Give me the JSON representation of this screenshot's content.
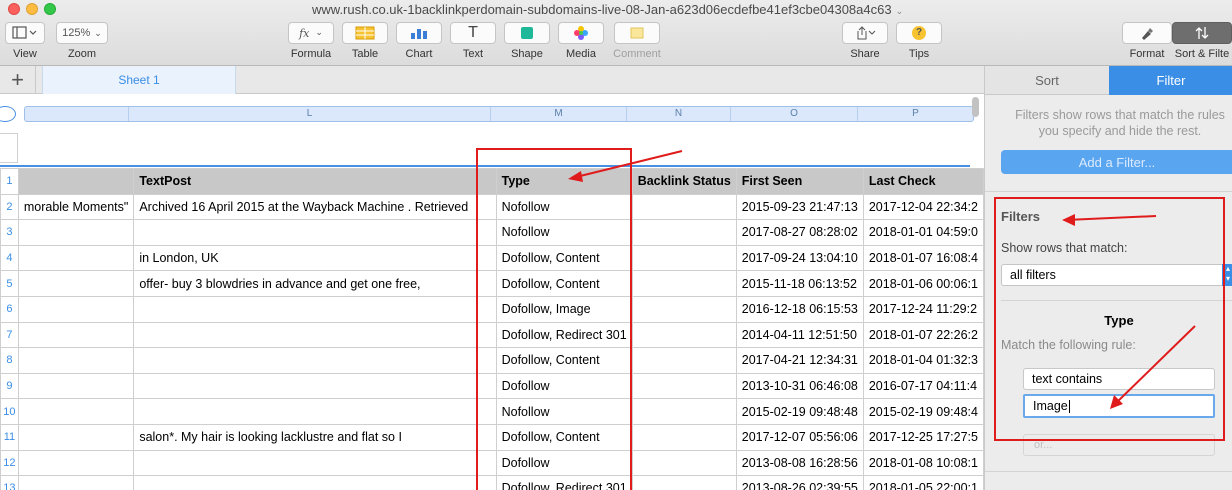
{
  "window": {
    "title": "www.rush.co.uk-1backlinkperdomain-subdomains-live-08-Jan-a623d06ecdefbe41ef3cbe04308a4c63"
  },
  "toolbar": {
    "view": "View",
    "zoom_value": "125%",
    "zoom": "Zoom",
    "formula_icon": "fx",
    "formula": "Formula",
    "table": "Table",
    "chart": "Chart",
    "text": "Text",
    "text_icon": "T",
    "shape": "Shape",
    "media": "Media",
    "comment": "Comment",
    "share": "Share",
    "tips": "Tips",
    "tips_icon": "?",
    "format": "Format",
    "sort_filter": "Sort & Filte"
  },
  "sheet": {
    "tab": "Sheet 1",
    "col_letters": [
      "L",
      "M",
      "N",
      "O",
      "P"
    ],
    "headers": [
      "",
      "TextPost",
      "Type",
      "Backlink Status",
      "First Seen",
      "Last Check"
    ],
    "rows": [
      {
        "n": "2",
        "k": "morable Moments\"",
        "textpost": "Archived 16 April 2015 at the Wayback Machine . Retrieved",
        "type": "Nofollow",
        "status": "",
        "first": "2015-09-23 21:47:13",
        "last": "2017-12-04 22:34:2"
      },
      {
        "n": "3",
        "k": "",
        "textpost": "",
        "type": "Nofollow",
        "status": "",
        "first": "2017-08-27 08:28:02",
        "last": "2018-01-01 04:59:0"
      },
      {
        "n": "4",
        "k": "",
        "textpost": "in London, UK",
        "type": "Dofollow, Content",
        "status": "",
        "first": "2017-09-24 13:04:10",
        "last": "2018-01-07 16:08:4"
      },
      {
        "n": "5",
        "k": "",
        "textpost": "offer- buy 3 blowdries in advance and get one free,",
        "type": "Dofollow, Content",
        "status": "",
        "first": "2015-11-18 06:13:52",
        "last": "2018-01-06 00:06:1"
      },
      {
        "n": "6",
        "k": "",
        "textpost": "",
        "type": "Dofollow, Image",
        "status": "",
        "first": "2016-12-18 06:15:53",
        "last": "2017-12-24 11:29:2"
      },
      {
        "n": "7",
        "k": "",
        "textpost": "",
        "type": "Dofollow, Redirect 301",
        "status": "",
        "first": "2014-04-11 12:51:50",
        "last": "2018-01-07 22:26:2"
      },
      {
        "n": "8",
        "k": "",
        "textpost": "",
        "type": "Dofollow, Content",
        "status": "",
        "first": "2017-04-21 12:34:31",
        "last": "2018-01-04 01:32:3"
      },
      {
        "n": "9",
        "k": "",
        "textpost": "",
        "type": "Dofollow",
        "status": "",
        "first": "2013-10-31 06:46:08",
        "last": "2016-07-17 04:11:4"
      },
      {
        "n": "10",
        "k": "",
        "textpost": "",
        "type": "Nofollow",
        "status": "",
        "first": "2015-02-19 09:48:48",
        "last": "2015-02-19 09:48:4"
      },
      {
        "n": "11",
        "k": "",
        "textpost": "salon*. My hair is looking lacklustre and flat so I",
        "type": "Dofollow, Content",
        "status": "",
        "first": "2017-12-07 05:56:06",
        "last": "2017-12-25 17:27:5"
      },
      {
        "n": "12",
        "k": "",
        "textpost": "",
        "type": "Dofollow",
        "status": "",
        "first": "2013-08-08 16:28:56",
        "last": "2018-01-08 10:08:1"
      },
      {
        "n": "13",
        "k": "",
        "textpost": "",
        "type": "Dofollow, Redirect 301",
        "status": "",
        "first": "2013-08-26 02:39:55",
        "last": "2018-01-05 22:00:1"
      }
    ],
    "header_row_num": "1"
  },
  "sidebar": {
    "tab_sort": "Sort",
    "tab_filter": "Filter",
    "description": "Filters show rows that match the rules you specify and hide the rest.",
    "add_filter": "Add a Filter...",
    "filters_title": "Filters",
    "show_rows": "Show rows that match:",
    "match_value": "all filters",
    "rule_column": "Type",
    "match_rule": "Match the following rule:",
    "condition": "text contains",
    "condition_value": "Image",
    "or_label": "or..."
  },
  "colors": {
    "accent": "#3a8ee6",
    "annotation": "#e01b1b",
    "header_fill": "#c8c8c8"
  }
}
